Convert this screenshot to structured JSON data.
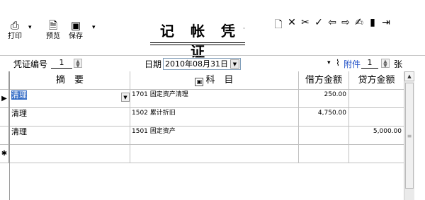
{
  "toolbar": {
    "print_label": "打印",
    "preview_label": "预览",
    "save_label": "保存",
    "dropdown_glyph": "▾"
  },
  "title": {
    "text": "记 帐 凭 证",
    "dropdown_glyph": "·"
  },
  "right_icons": [
    {
      "name": "new-doc-icon",
      "glyph": "🗋"
    },
    {
      "name": "close-icon",
      "glyph": "✕"
    },
    {
      "name": "tools-icon",
      "glyph": "✂"
    },
    {
      "name": "check-icon",
      "glyph": "✓"
    },
    {
      "name": "arrow-left-icon",
      "glyph": "⇦"
    },
    {
      "name": "arrow-right-icon",
      "glyph": "⇨"
    },
    {
      "name": "sign-icon",
      "glyph": "✍"
    },
    {
      "name": "clip-icon",
      "glyph": "▮"
    },
    {
      "name": "exit-icon",
      "glyph": "⇥"
    }
  ],
  "voucher": {
    "number_label": "凭证编号",
    "number_value": "1",
    "date_label": "日期",
    "date_value": "2010年08月31日",
    "attach_label": "附件",
    "attach_count": "1",
    "attach_unit": "张"
  },
  "grid": {
    "headers": {
      "summary": "摘　要",
      "account": "科　目",
      "debit": "借方金额",
      "credit": "贷方金额"
    },
    "rows": [
      {
        "indicator": "▶",
        "summary": "清理",
        "account": "1701 固定资产清理",
        "debit": "250.00",
        "credit": ""
      },
      {
        "indicator": "",
        "summary": "清理",
        "account": "1502 累计折旧",
        "debit": "4,750.00",
        "credit": ""
      },
      {
        "indicator": "",
        "summary": "清理",
        "account": "1501 固定资产",
        "debit": "",
        "credit": "5,000.00"
      },
      {
        "indicator": "✱",
        "summary": "",
        "account": "",
        "debit": "",
        "credit": ""
      }
    ]
  },
  "colors": {
    "selection": "#316ac5",
    "attach_link": "#2050c8"
  }
}
